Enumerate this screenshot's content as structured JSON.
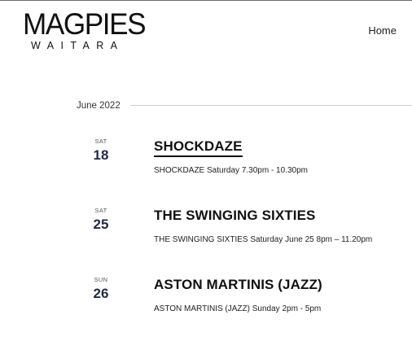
{
  "header": {
    "logo_main": "MAGPIES",
    "logo_sub": "WAITARA",
    "nav_home": "Home"
  },
  "events": {
    "month": "June 2022",
    "items": [
      {
        "dow": "SAT",
        "day": "18",
        "title": "SHOCKDAZE",
        "description": "SHOCKDAZE Saturday 7.30pm - 10.30pm"
      },
      {
        "dow": "SAT",
        "day": "25",
        "title": "THE SWINGING SIXTIES",
        "description": "THE SWINGING SIXTIES Saturday June 25 8pm – 11.20pm"
      },
      {
        "dow": "SUN",
        "day": "26",
        "title": "ASTON MARTINIS (JAZZ)",
        "description": "ASTON MARTINIS (JAZZ) Sunday 2pm - 5pm"
      }
    ]
  }
}
